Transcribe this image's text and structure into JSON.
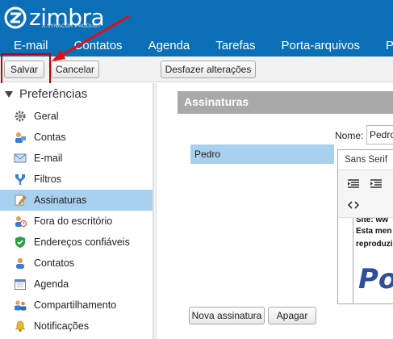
{
  "app": {
    "logo_text": "zimbra",
    "logo_sub": "A SYNACOR PRODUCT",
    "brand_color": "#0b6fb8"
  },
  "tabs": [
    {
      "label": "E-mail"
    },
    {
      "label": "Contatos"
    },
    {
      "label": "Agenda"
    },
    {
      "label": "Tarefas"
    },
    {
      "label": "Porta-arquivos"
    },
    {
      "label": "Pre"
    }
  ],
  "toolbar": {
    "save_label": "Salvar",
    "cancel_label": "Cancelar",
    "undo_label": "Desfazer alterações"
  },
  "sidebar": {
    "title": "Preferências",
    "items": [
      {
        "label": "Geral",
        "icon": "gear-icon"
      },
      {
        "label": "Contas",
        "icon": "accounts-icon"
      },
      {
        "label": "E-mail",
        "icon": "envelope-icon"
      },
      {
        "label": "Filtros",
        "icon": "filter-icon"
      },
      {
        "label": "Assinaturas",
        "icon": "signature-icon",
        "selected": true
      },
      {
        "label": "Fora do escritório",
        "icon": "out-of-office-icon"
      },
      {
        "label": "Endereços confiáveis",
        "icon": "shield-check-icon"
      },
      {
        "label": "Contatos",
        "icon": "contacts-icon"
      },
      {
        "label": "Agenda",
        "icon": "calendar-icon"
      },
      {
        "label": "Compartilhamento",
        "icon": "sharing-icon"
      },
      {
        "label": "Notificações",
        "icon": "bell-icon"
      }
    ]
  },
  "main": {
    "section_title": "Assinaturas",
    "name_label": "Nome:",
    "name_value": "Pedro",
    "signatures": [
      {
        "name": "Pedro"
      }
    ],
    "editor": {
      "font": "Sans Serif",
      "content_lines": [
        "Site: ww",
        "Esta men",
        "reproduzi"
      ],
      "logo_text": "Po"
    },
    "new_signature_label": "Nova assinatura",
    "delete_label": "Apagar"
  }
}
